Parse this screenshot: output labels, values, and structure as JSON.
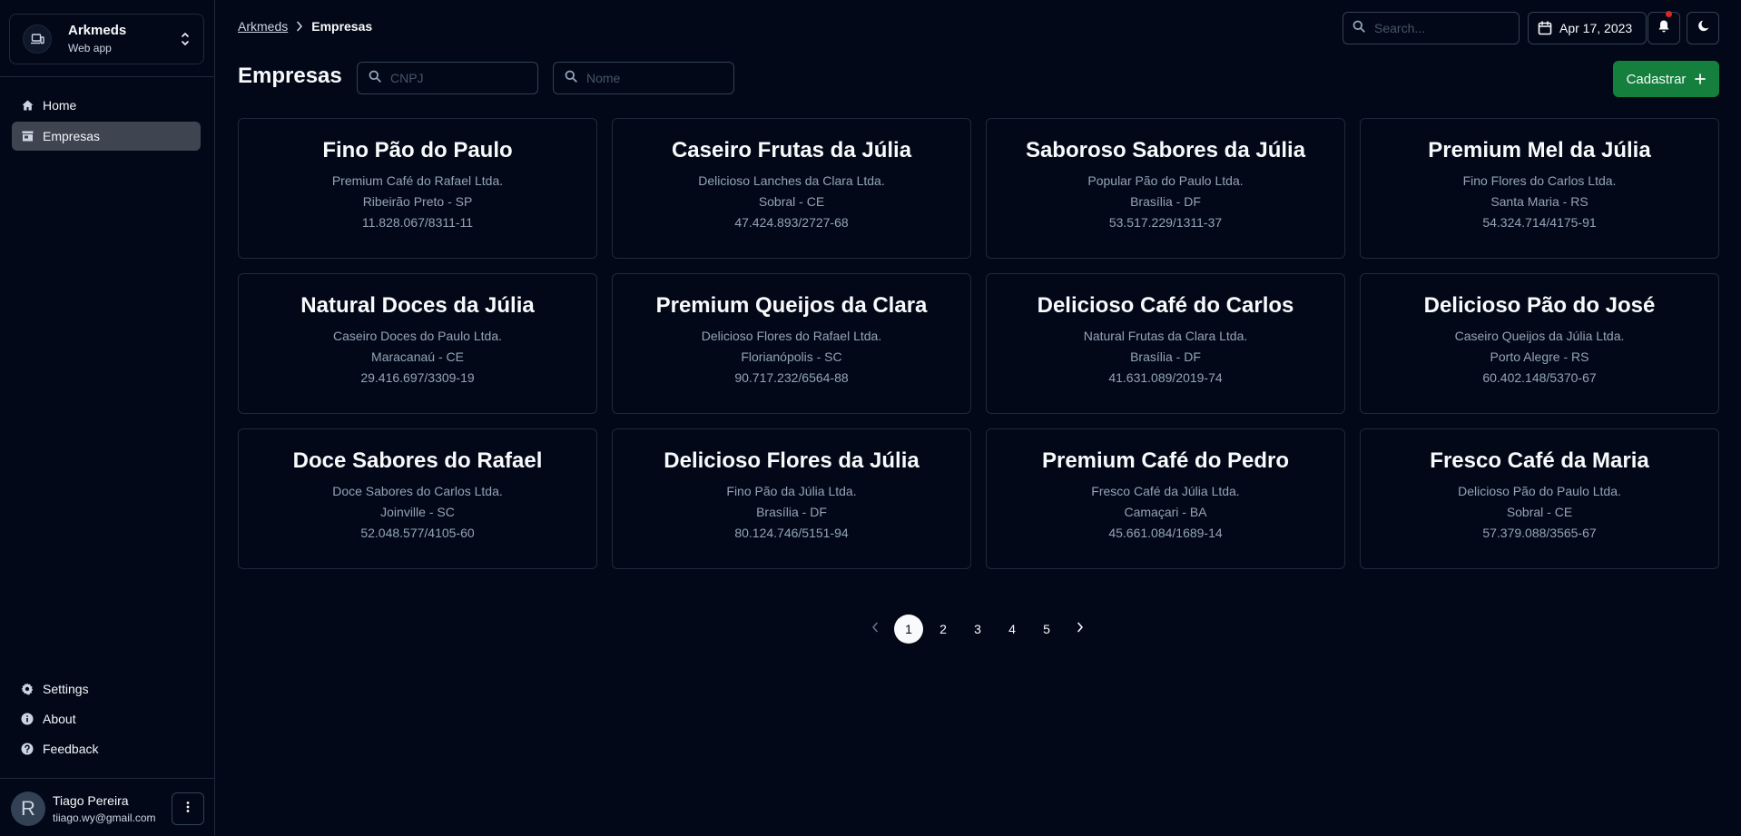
{
  "app": {
    "name": "Arkmeds",
    "subtitle": "Web app"
  },
  "sidebar": {
    "nav": [
      {
        "label": "Home",
        "icon": "home-icon"
      },
      {
        "label": "Empresas",
        "icon": "store-icon",
        "active": true
      }
    ],
    "bottom": [
      {
        "label": "Settings",
        "icon": "gear-icon"
      },
      {
        "label": "About",
        "icon": "info-icon"
      },
      {
        "label": "Feedback",
        "icon": "help-icon"
      }
    ]
  },
  "user": {
    "initial": "R",
    "name": "Tiago Pereira",
    "email": "tiiago.wy@gmail.com"
  },
  "breadcrumb": {
    "root": "Arkmeds",
    "current": "Empresas"
  },
  "header": {
    "search_placeholder": "Search...",
    "date": "Apr 17, 2023"
  },
  "page": {
    "title": "Empresas",
    "cnpj_placeholder": "CNPJ",
    "nome_placeholder": "Nome",
    "add_label": "Cadastrar"
  },
  "companies": [
    {
      "name": "Fino Pão do Paulo",
      "legal_name": "Premium Café do Rafael Ltda.",
      "location": "Ribeirão Preto - SP",
      "cnpj": "11.828.067/8311-11"
    },
    {
      "name": "Caseiro Frutas da Júlia",
      "legal_name": "Delicioso Lanches da Clara Ltda.",
      "location": "Sobral - CE",
      "cnpj": "47.424.893/2727-68"
    },
    {
      "name": "Saboroso Sabores da Júlia",
      "legal_name": "Popular Pão do Paulo Ltda.",
      "location": "Brasília - DF",
      "cnpj": "53.517.229/1311-37"
    },
    {
      "name": "Premium Mel da Júlia",
      "legal_name": "Fino Flores do Carlos Ltda.",
      "location": "Santa Maria - RS",
      "cnpj": "54.324.714/4175-91"
    },
    {
      "name": "Natural Doces da Júlia",
      "legal_name": "Caseiro Doces do Paulo Ltda.",
      "location": "Maracanaú - CE",
      "cnpj": "29.416.697/3309-19"
    },
    {
      "name": "Premium Queijos da Clara",
      "legal_name": "Delicioso Flores do Rafael Ltda.",
      "location": "Florianópolis - SC",
      "cnpj": "90.717.232/6564-88"
    },
    {
      "name": "Delicioso Café do Carlos",
      "legal_name": "Natural Frutas da Clara Ltda.",
      "location": "Brasília - DF",
      "cnpj": "41.631.089/2019-74"
    },
    {
      "name": "Delicioso Pão do José",
      "legal_name": "Caseiro Queijos da Júlia Ltda.",
      "location": "Porto Alegre - RS",
      "cnpj": "60.402.148/5370-67"
    },
    {
      "name": "Doce Sabores do Rafael",
      "legal_name": "Doce Sabores do Carlos Ltda.",
      "location": "Joinville - SC",
      "cnpj": "52.048.577/4105-60"
    },
    {
      "name": "Delicioso Flores da Júlia",
      "legal_name": "Fino Pão da Júlia Ltda.",
      "location": "Brasília - DF",
      "cnpj": "80.124.746/5151-94"
    },
    {
      "name": "Premium Café do Pedro",
      "legal_name": "Fresco Café da Júlia Ltda.",
      "location": "Camaçari - BA",
      "cnpj": "45.661.084/1689-14"
    },
    {
      "name": "Fresco Café da Maria",
      "legal_name": "Delicioso Pão do Paulo Ltda.",
      "location": "Sobral - CE",
      "cnpj": "57.379.088/3565-67"
    }
  ],
  "pagination": {
    "pages": [
      "1",
      "2",
      "3",
      "4",
      "5"
    ],
    "current": "1"
  },
  "colors": {
    "background": "#020817",
    "accent_green": "#15803d",
    "active_nav": "#3f4550",
    "notification_dot": "#dc2626"
  }
}
